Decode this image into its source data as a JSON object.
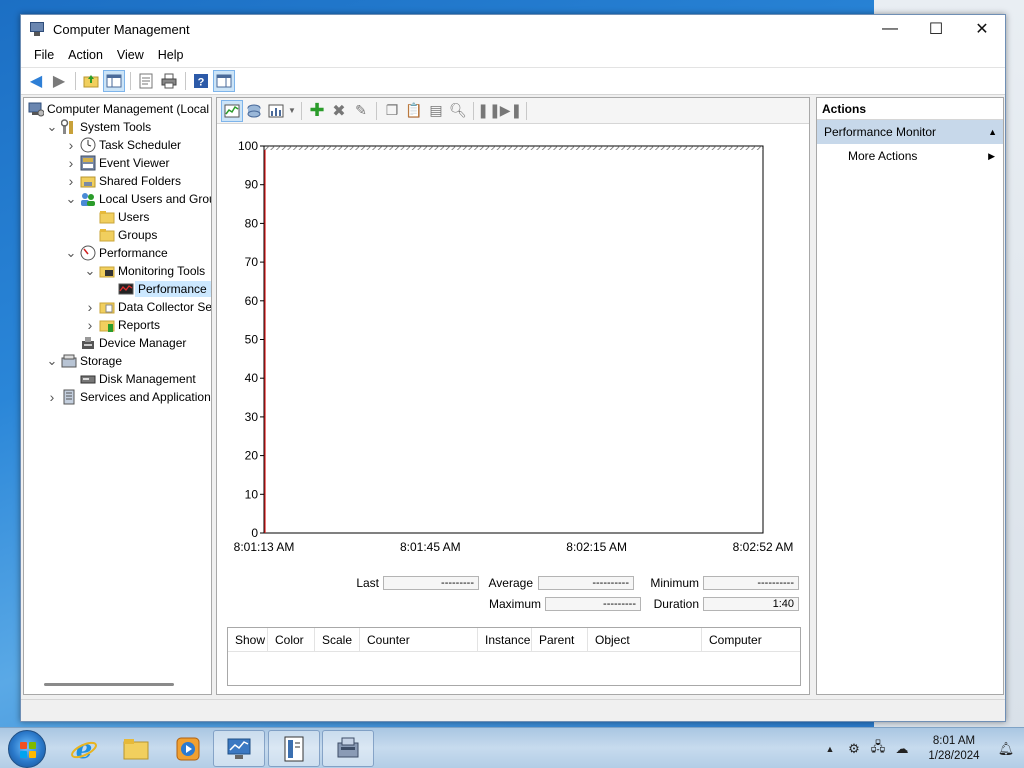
{
  "window": {
    "title": "Computer Management",
    "controls": {
      "minimize": "—",
      "maximize": "☐",
      "close": "✕"
    }
  },
  "menu": [
    "File",
    "Action",
    "View",
    "Help"
  ],
  "tree": [
    {
      "label": "Computer Management (Local",
      "level": 0,
      "expander": "",
      "icon": "computer-management-icon"
    },
    {
      "label": "System Tools",
      "level": 1,
      "expander": "v",
      "icon": "system-tools-icon"
    },
    {
      "label": "Task Scheduler",
      "level": 2,
      "expander": ">",
      "icon": "clock-icon"
    },
    {
      "label": "Event Viewer",
      "level": 2,
      "expander": ">",
      "icon": "event-viewer-icon"
    },
    {
      "label": "Shared Folders",
      "level": 2,
      "expander": ">",
      "icon": "shared-folder-icon"
    },
    {
      "label": "Local Users and Groups",
      "level": 2,
      "expander": "v",
      "icon": "users-icon"
    },
    {
      "label": "Users",
      "level": 3,
      "expander": "",
      "icon": "folder-icon"
    },
    {
      "label": "Groups",
      "level": 3,
      "expander": "",
      "icon": "folder-icon"
    },
    {
      "label": "Performance",
      "level": 2,
      "expander": "v",
      "icon": "performance-icon"
    },
    {
      "label": "Monitoring Tools",
      "level": 3,
      "expander": "v",
      "icon": "monitoring-folder-icon"
    },
    {
      "label": "Performance Mo",
      "level": 4,
      "expander": "",
      "icon": "perf-monitor-icon",
      "selected": true
    },
    {
      "label": "Data Collector Sets",
      "level": 3,
      "expander": ">",
      "icon": "data-collector-folder-icon"
    },
    {
      "label": "Reports",
      "level": 3,
      "expander": ">",
      "icon": "reports-folder-icon"
    },
    {
      "label": "Device Manager",
      "level": 2,
      "expander": "",
      "icon": "device-manager-icon"
    },
    {
      "label": "Storage",
      "level": 1,
      "expander": "v",
      "icon": "storage-icon"
    },
    {
      "label": "Disk Management",
      "level": 2,
      "expander": "",
      "icon": "disk-management-icon"
    },
    {
      "label": "Services and Applications",
      "level": 1,
      "expander": ">",
      "icon": "services-icon"
    }
  ],
  "chart_data": {
    "type": "line",
    "title": "",
    "xlabel": "",
    "ylabel": "",
    "ylim": [
      0,
      100
    ],
    "yticks": [
      0,
      10,
      20,
      30,
      40,
      50,
      60,
      70,
      80,
      90,
      100
    ],
    "xticks": [
      "8:01:13 AM",
      "8:01:45 AM",
      "8:02:15 AM",
      "8:02:52 AM"
    ],
    "series": [],
    "grid": false
  },
  "stats": {
    "last_label": "Last",
    "last_value": "---------",
    "average_label": "Average",
    "average_value": "----------",
    "minimum_label": "Minimum",
    "minimum_value": "----------",
    "maximum_label": "Maximum",
    "maximum_value": "---------",
    "duration_label": "Duration",
    "duration_value": "1:40"
  },
  "counter_table": {
    "columns": [
      "Show",
      "Color",
      "Scale",
      "Counter",
      "Instance",
      "Parent",
      "Object",
      "Computer"
    ]
  },
  "actions": {
    "header": "Actions",
    "section": "Performance Monitor",
    "items": [
      "More Actions"
    ]
  },
  "taskbar": {
    "clock_time": "8:01 AM",
    "clock_date": "1/28/2024"
  }
}
